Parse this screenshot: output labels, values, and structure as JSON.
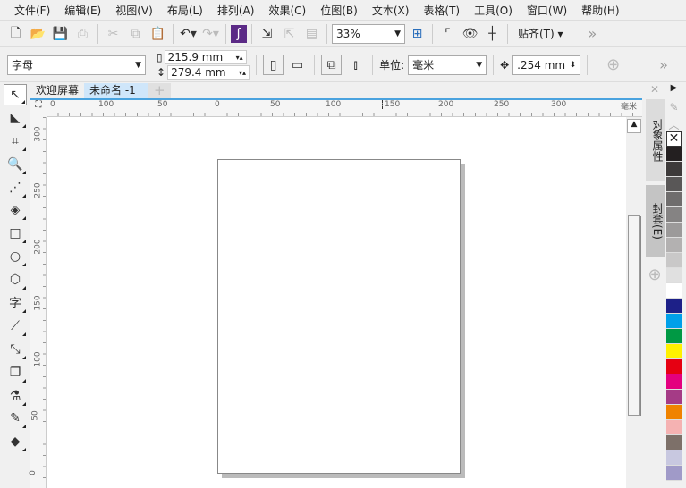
{
  "menu": [
    "文件(F)",
    "编辑(E)",
    "视图(V)",
    "布局(L)",
    "排列(A)",
    "效果(C)",
    "位图(B)",
    "文本(X)",
    "表格(T)",
    "工具(O)",
    "窗口(W)",
    "帮助(H)"
  ],
  "toolbar": {
    "zoom": "33%",
    "snap": "贴齐(T)",
    "more": "»"
  },
  "propbar": {
    "preset": "字母",
    "width": "215.9 mm",
    "height": "279.4 mm",
    "unit_label": "单位:",
    "unit": "毫米",
    "nudge": ".254 mm",
    "more": "»"
  },
  "tabs": [
    {
      "label": "欢迎屏幕"
    },
    {
      "label": "未命名 -1"
    }
  ],
  "hruler": {
    "labels": [
      "0",
      "100",
      "50",
      "0",
      "50",
      "100",
      "150",
      "200",
      "250",
      "300"
    ],
    "unit": "毫米"
  },
  "vruler": {
    "labels": [
      "300",
      "250",
      "200",
      "150",
      "100",
      "50",
      "0"
    ]
  },
  "docker": {
    "tabs": [
      "对象属性",
      "封套(E)"
    ]
  },
  "palette": [
    "#231f20",
    "#3d3a3a",
    "#595757",
    "#6f6d6d",
    "#858383",
    "#9c9a9a",
    "#b3b1b1",
    "#c9c8c8",
    "#e0e0e0",
    "#ffffff",
    "#1d2088",
    "#00a0e9",
    "#009944",
    "#fff100",
    "#e60012",
    "#e4007f",
    "#a53b86",
    "#f08300",
    "#f5b2b2",
    "#7d7069",
    "#c8c8e0",
    "#a09ac8"
  ]
}
